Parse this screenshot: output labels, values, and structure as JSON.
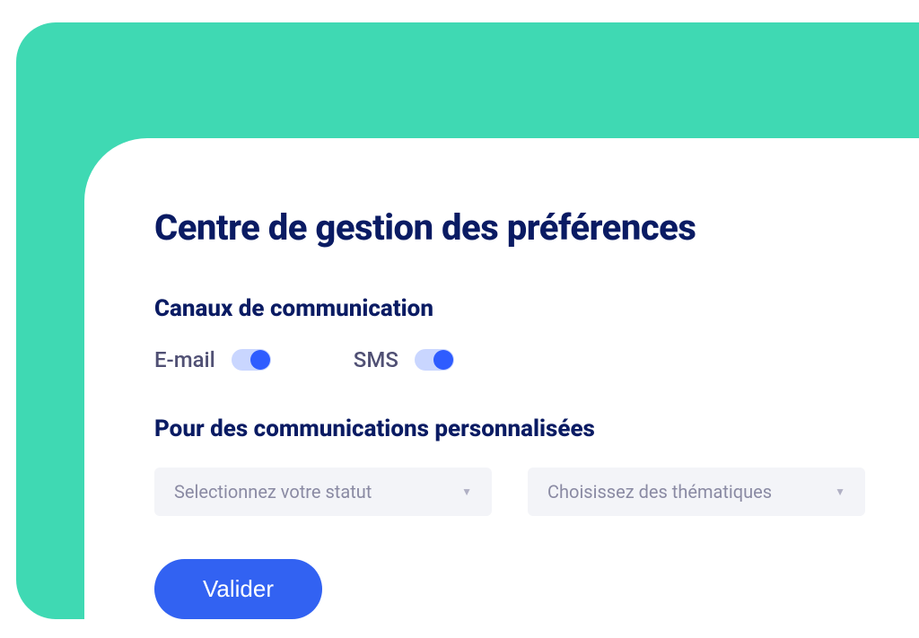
{
  "title": "Centre de gestion des préférences",
  "channels": {
    "heading": "Canaux de communication",
    "email_label": "E-mail",
    "email_on": true,
    "sms_label": "SMS",
    "sms_on": true
  },
  "personalized": {
    "heading": "Pour des communications personnalisées",
    "status_placeholder": "Selectionnez votre statut",
    "themes_placeholder": "Choisissez des thématiques"
  },
  "submit_label": "Valider"
}
